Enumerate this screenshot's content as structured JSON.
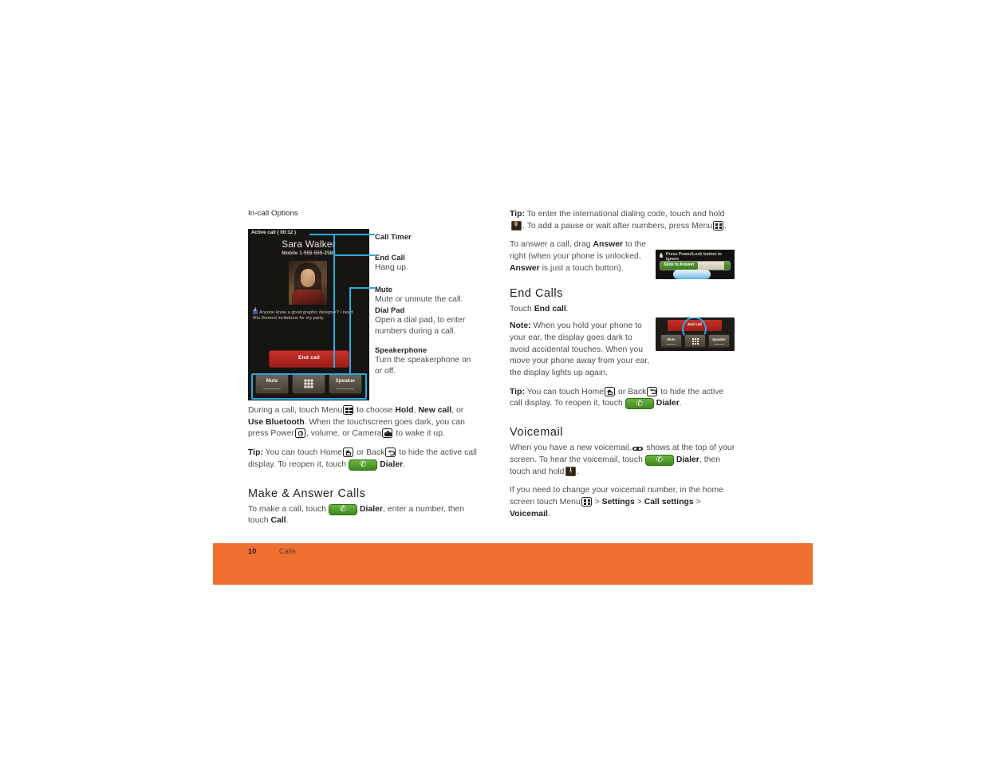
{
  "document": {
    "footer": {
      "page_number": "10",
      "section": "Calls"
    }
  },
  "left_column": {
    "heading": "In-call Options",
    "phone_figure": {
      "status": "Active call ( 00:12 )",
      "contact_name": "Sara Walker",
      "contact_number": "Mobile 1-555-555-2588",
      "status_update": "Anyone know a good graphic designer? I need 60s themed invitations for my party.",
      "end_call_label": "End call",
      "buttons": {
        "mute": "Mute",
        "dial_pad": "dial-pad",
        "speaker": "Speaker"
      }
    },
    "callouts": [
      {
        "title": "Call Timer",
        "desc": ""
      },
      {
        "title": "End Call",
        "desc": "Hang up."
      },
      {
        "title": "Mute",
        "desc": "Mute or unmute the call."
      },
      {
        "title": "Dial Pad",
        "desc": "Open a dial pad, to enter numbers during a call."
      },
      {
        "title": "Speakerphone",
        "desc": "Turn the speakerphone on or off."
      }
    ],
    "paragraphs": {
      "during_call_1": "During a call, touch Menu",
      "during_call_2": " to choose ",
      "hold": "Hold",
      "comma1": ", ",
      "new_call": "New call",
      "comma2": ", or ",
      "use_bluetooth": "Use Bluetooth",
      "during_call_3": ". When the touchscreen goes dark, you can press Power",
      "during_call_4": ", volume, or Camera",
      "during_call_5": " to wake it up.",
      "tip_label": "Tip:",
      "tip_1": " You can touch Home",
      "tip_2": " or Back",
      "tip_3": " to hide the active call display. To reopen it, touch",
      "dialer": "Dialer",
      "period": "."
    },
    "make_answer": {
      "heading": "Make & Answer Calls",
      "line_1": "To make a call, touch",
      "dialer": "Dialer",
      "line_2": ", enter a number, then touch ",
      "call": "Call",
      "period": "."
    }
  },
  "right_column": {
    "tip_intl": {
      "label": "Tip:",
      "text_1": " To enter the international dialing code, touch and hold",
      "key_0": "0",
      "text_2": ". To add a pause or wait after numbers, press Menu",
      "text_3": "."
    },
    "answer_para": {
      "text_1": "To answer a call, drag ",
      "answer_1": "Answer",
      "text_2": " to the right (when your phone is unlocked, ",
      "answer_2": "Answer",
      "text_3": " is just a touch button)."
    },
    "answer_figure": {
      "lock_text": "Press Power/Lock button to ignore",
      "slider_label": "Slide to Answer"
    },
    "end_calls": {
      "heading": "End Calls",
      "touch_text": "Touch ",
      "end_call": "End call",
      "period": ".",
      "note_label": "Note:",
      "note_text": " When you hold your phone to your ear, the display goes dark to avoid accidental touches. When you move your phone away from your ear, the display lights up again.",
      "tip_label": "Tip:",
      "tip_1": " You can touch Home",
      "tip_2": " or Back",
      "tip_3": " to hide the active call display. To reopen it, touch",
      "dialer": "Dialer",
      "period2": "."
    },
    "end_figure": {
      "end_call_label": "End call",
      "mute": "Mute",
      "speaker": "Speaker"
    },
    "voicemail": {
      "heading": "Voicemail",
      "line_1": "When you have a new voicemail,",
      "line_2": " shows at the top of your screen. To hear the voicemail, touch",
      "dialer": "Dialer",
      "line_3": ", then touch and hold",
      "key_1": "1",
      "period": ".",
      "change_1": "If you need to change your voicemail number, in the home screen touch Menu",
      "gt1": " > ",
      "settings": "Settings",
      "gt2": " > ",
      "call_settings": "Call settings",
      "gt3": " > ",
      "voicemail_item": "Voicemail",
      "period2": "."
    }
  },
  "colors": {
    "footer_band": "#f07032",
    "highlight_blue": "#29abe2",
    "dialer_green": "#3f8a1f",
    "end_call_red": "#c6302a"
  }
}
